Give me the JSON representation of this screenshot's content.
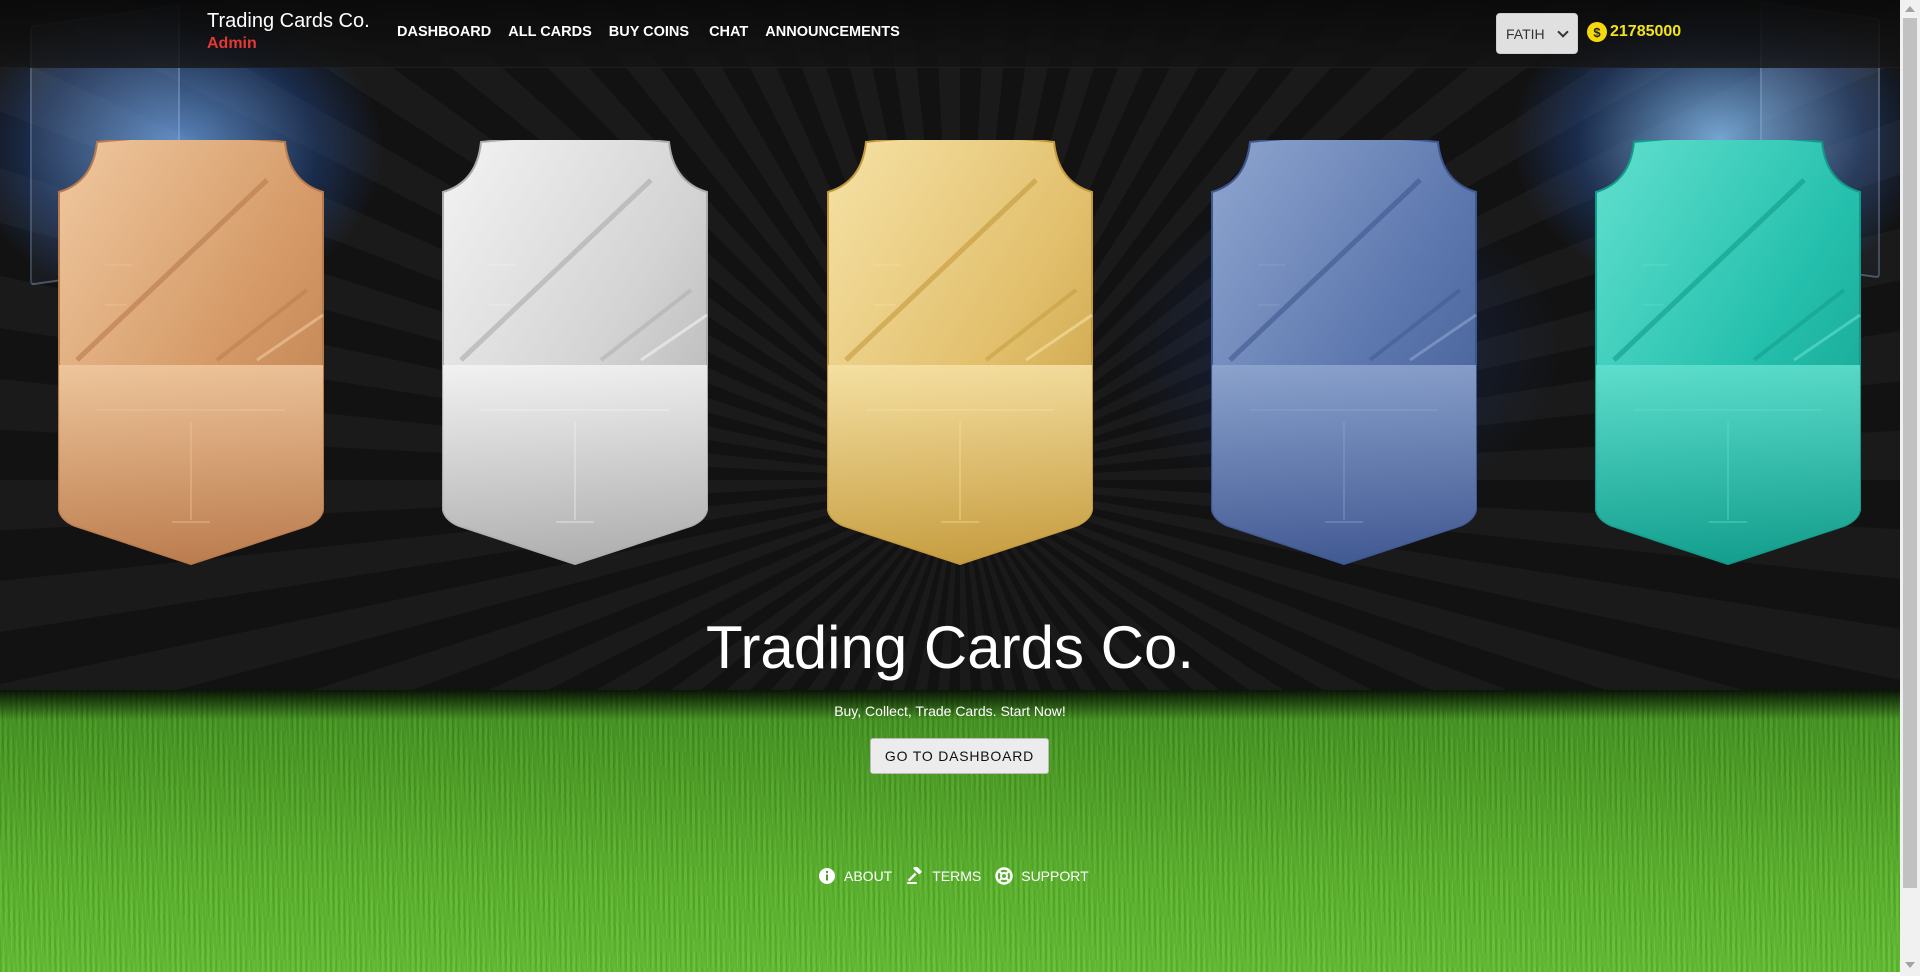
{
  "brand": {
    "title": "Trading Cards Co.",
    "role": "Admin"
  },
  "nav": {
    "links": [
      "DASHBOARD",
      "ALL CARDS",
      "BUY COINS",
      "CHAT",
      "ANNOUNCEMENTS"
    ]
  },
  "user": {
    "name": "FATIH",
    "icon": "chevron-down-icon"
  },
  "coins": {
    "symbol": "$",
    "amount": "21785000",
    "color": "#f5e31a"
  },
  "cards": [
    {
      "tier": "bronze",
      "colors": [
        "#f0c9a0",
        "#d59a67",
        "#b97a4c"
      ]
    },
    {
      "tier": "silver",
      "colors": [
        "#f4f4f4",
        "#d3d3d3",
        "#ababab"
      ]
    },
    {
      "tier": "gold",
      "colors": [
        "#f6e2a6",
        "#e2c06d",
        "#c49a3c"
      ]
    },
    {
      "tier": "blue",
      "colors": [
        "#8fa6cf",
        "#5c77ae",
        "#3f5790"
      ]
    },
    {
      "tier": "teal",
      "colors": [
        "#63e0cf",
        "#25c0ad",
        "#129b8a"
      ]
    }
  ],
  "hero": {
    "title": "Trading Cards Co.",
    "subtitle": "Buy, Collect, Trade Cards. Start Now!",
    "button": "GO TO DASHBOARD"
  },
  "footer": {
    "links": [
      {
        "label": "ABOUT",
        "icon": "info-icon"
      },
      {
        "label": "TERMS",
        "icon": "gavel-icon"
      },
      {
        "label": "SUPPORT",
        "icon": "support-icon"
      }
    ]
  }
}
